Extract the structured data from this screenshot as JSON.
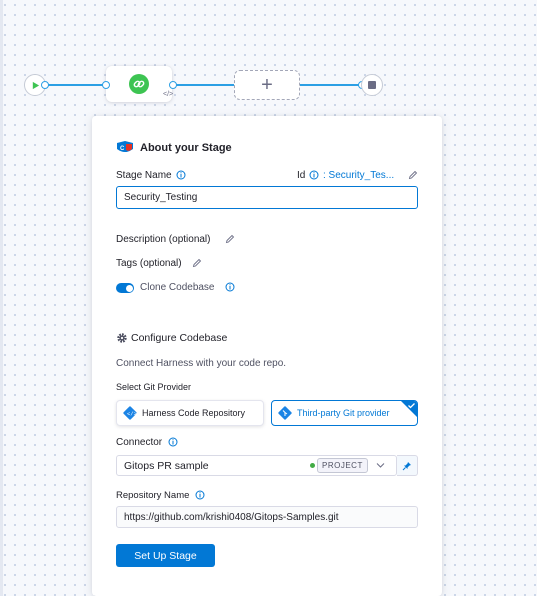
{
  "pipeline": {
    "add_symbol": "+",
    "stage_code_glyph": "</>",
    "accent_color": "#2c9fe4"
  },
  "panel": {
    "title": "About your Stage",
    "stage_name_label": "Stage Name",
    "id_label": "Id",
    "id_value": ": Security_Tes...",
    "stage_name_value": "Security_Testing",
    "description_label": "Description (optional)",
    "tags_label": "Tags (optional)",
    "clone_codebase_label": "Clone Codebase",
    "clone_codebase_enabled": true,
    "configure_codebase_title": "Configure Codebase",
    "connect_text": "Connect Harness with your code repo.",
    "select_git_provider_label": "Select Git Provider",
    "providers": [
      {
        "label": "Harness Code Repository",
        "selected": false
      },
      {
        "label": "Third-party Git provider",
        "selected": true
      }
    ],
    "connector_label": "Connector",
    "connector_value": "Gitops PR sample",
    "connector_scope": "PROJECT",
    "repository_name_label": "Repository Name",
    "repository_value": "https://github.com/krishi0408/Gitops-Samples.git",
    "submit_label": "Set Up Stage"
  },
  "icons": [
    "play-icon",
    "stop-icon",
    "link-icon",
    "plus-icon",
    "ci-logo-icon",
    "info-icon",
    "pencil-icon",
    "gear-icon",
    "harness-code-icon",
    "git-icon",
    "chevron-down-icon",
    "pin-icon",
    "checkmark-icon"
  ],
  "colors": {
    "primary": "#0278d5",
    "stage_green": "#3dc452",
    "status_green": "#42ab45",
    "start_arrow": "#3dc452"
  }
}
